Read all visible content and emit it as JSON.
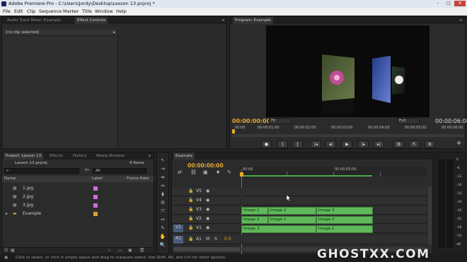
{
  "window": {
    "title": "Adobe Premiere Pro - C:\\Users\\Jordy\\Desktop\\Lesson 13.prproj *",
    "minimize": "–",
    "maximize": "□",
    "close": "✕"
  },
  "menu": [
    "File",
    "Edit",
    "Clip",
    "Sequence",
    "Marker",
    "Title",
    "Window",
    "Help"
  ],
  "source_panel": {
    "tabs": [
      "Audio Track Mixer: Example",
      "Effect Controls",
      "≡"
    ],
    "clip_label": "(no clip selected)",
    "arrow": "▸"
  },
  "program_monitor": {
    "tab": "Program: Example",
    "menu_icon": "≡",
    "current_time": "00:00:00:00",
    "fit": "Fit",
    "quality": "Full",
    "duration": "00:00:06:08",
    "ruler_labels": [
      "00:00",
      "00:00:01:00",
      "00:00:02:00",
      "00:00:03:00",
      "00:00:04:00",
      "00:00:05:00",
      "00:00:06:00"
    ],
    "controls": [
      "●",
      "{",
      "}",
      "|◂",
      "◂|",
      "▶",
      "|▸",
      "▸|",
      "⧉",
      "⇱",
      "⚙",
      "+"
    ]
  },
  "project_panel": {
    "tabs": [
      "Project: Lesson 13",
      "Effects",
      "History",
      "Media Browser",
      "≡"
    ],
    "file": "Lesson 13.prproj",
    "count": "4 Items",
    "in_label": "In:",
    "in_value": "All",
    "columns": [
      "Name",
      "Label",
      "Frame Rate"
    ],
    "items": [
      {
        "name": "1.jpg",
        "color": "#d36bd6",
        "type": "file"
      },
      {
        "name": "2.jpg",
        "color": "#d36bd6",
        "type": "file"
      },
      {
        "name": "3.jpg",
        "color": "#d36bd6",
        "type": "file"
      },
      {
        "name": "Example",
        "color": "#e39a3d",
        "type": "folder"
      }
    ]
  },
  "tools": [
    "↖",
    "⇥",
    "⇹",
    "⇔",
    "⧫",
    "⧉",
    "⤧",
    "↔",
    "✎",
    "✋",
    "🔍"
  ],
  "timeline": {
    "tab": "Example",
    "timecode": "00:00:00:00",
    "ruler_labels": [
      "00:00",
      "00:00:05:00"
    ],
    "tracks": [
      {
        "name": "V5",
        "clips": []
      },
      {
        "name": "V4",
        "clips": []
      },
      {
        "name": "V3",
        "clips": [
          "Image 1",
          "Image 2",
          "Image 3"
        ]
      },
      {
        "name": "V2",
        "clips": [
          "Image 2",
          "Image 1",
          "Image 2"
        ]
      },
      {
        "name": "V1",
        "source": "V1",
        "clips": [
          "Image 3",
          "Image 1"
        ]
      },
      {
        "name": "A1",
        "source": "A1",
        "clips": []
      }
    ],
    "audio_labels": [
      "M",
      "S",
      "0.0"
    ]
  },
  "meter": {
    "labels": [
      "0",
      "-6",
      "-12",
      "-18",
      "-24",
      "-30",
      "-36",
      "-42",
      "-48",
      "-54",
      "dB"
    ]
  },
  "status": "Click to select, or click in empty space and drag to marquee select. Use Shift, Alt, and Ctrl for other options.",
  "watermark": "GHOSTXX.COM",
  "colors": {
    "clip": "#5fb95a",
    "accent": "#e5a92e",
    "playhead": "#e5a92e"
  }
}
